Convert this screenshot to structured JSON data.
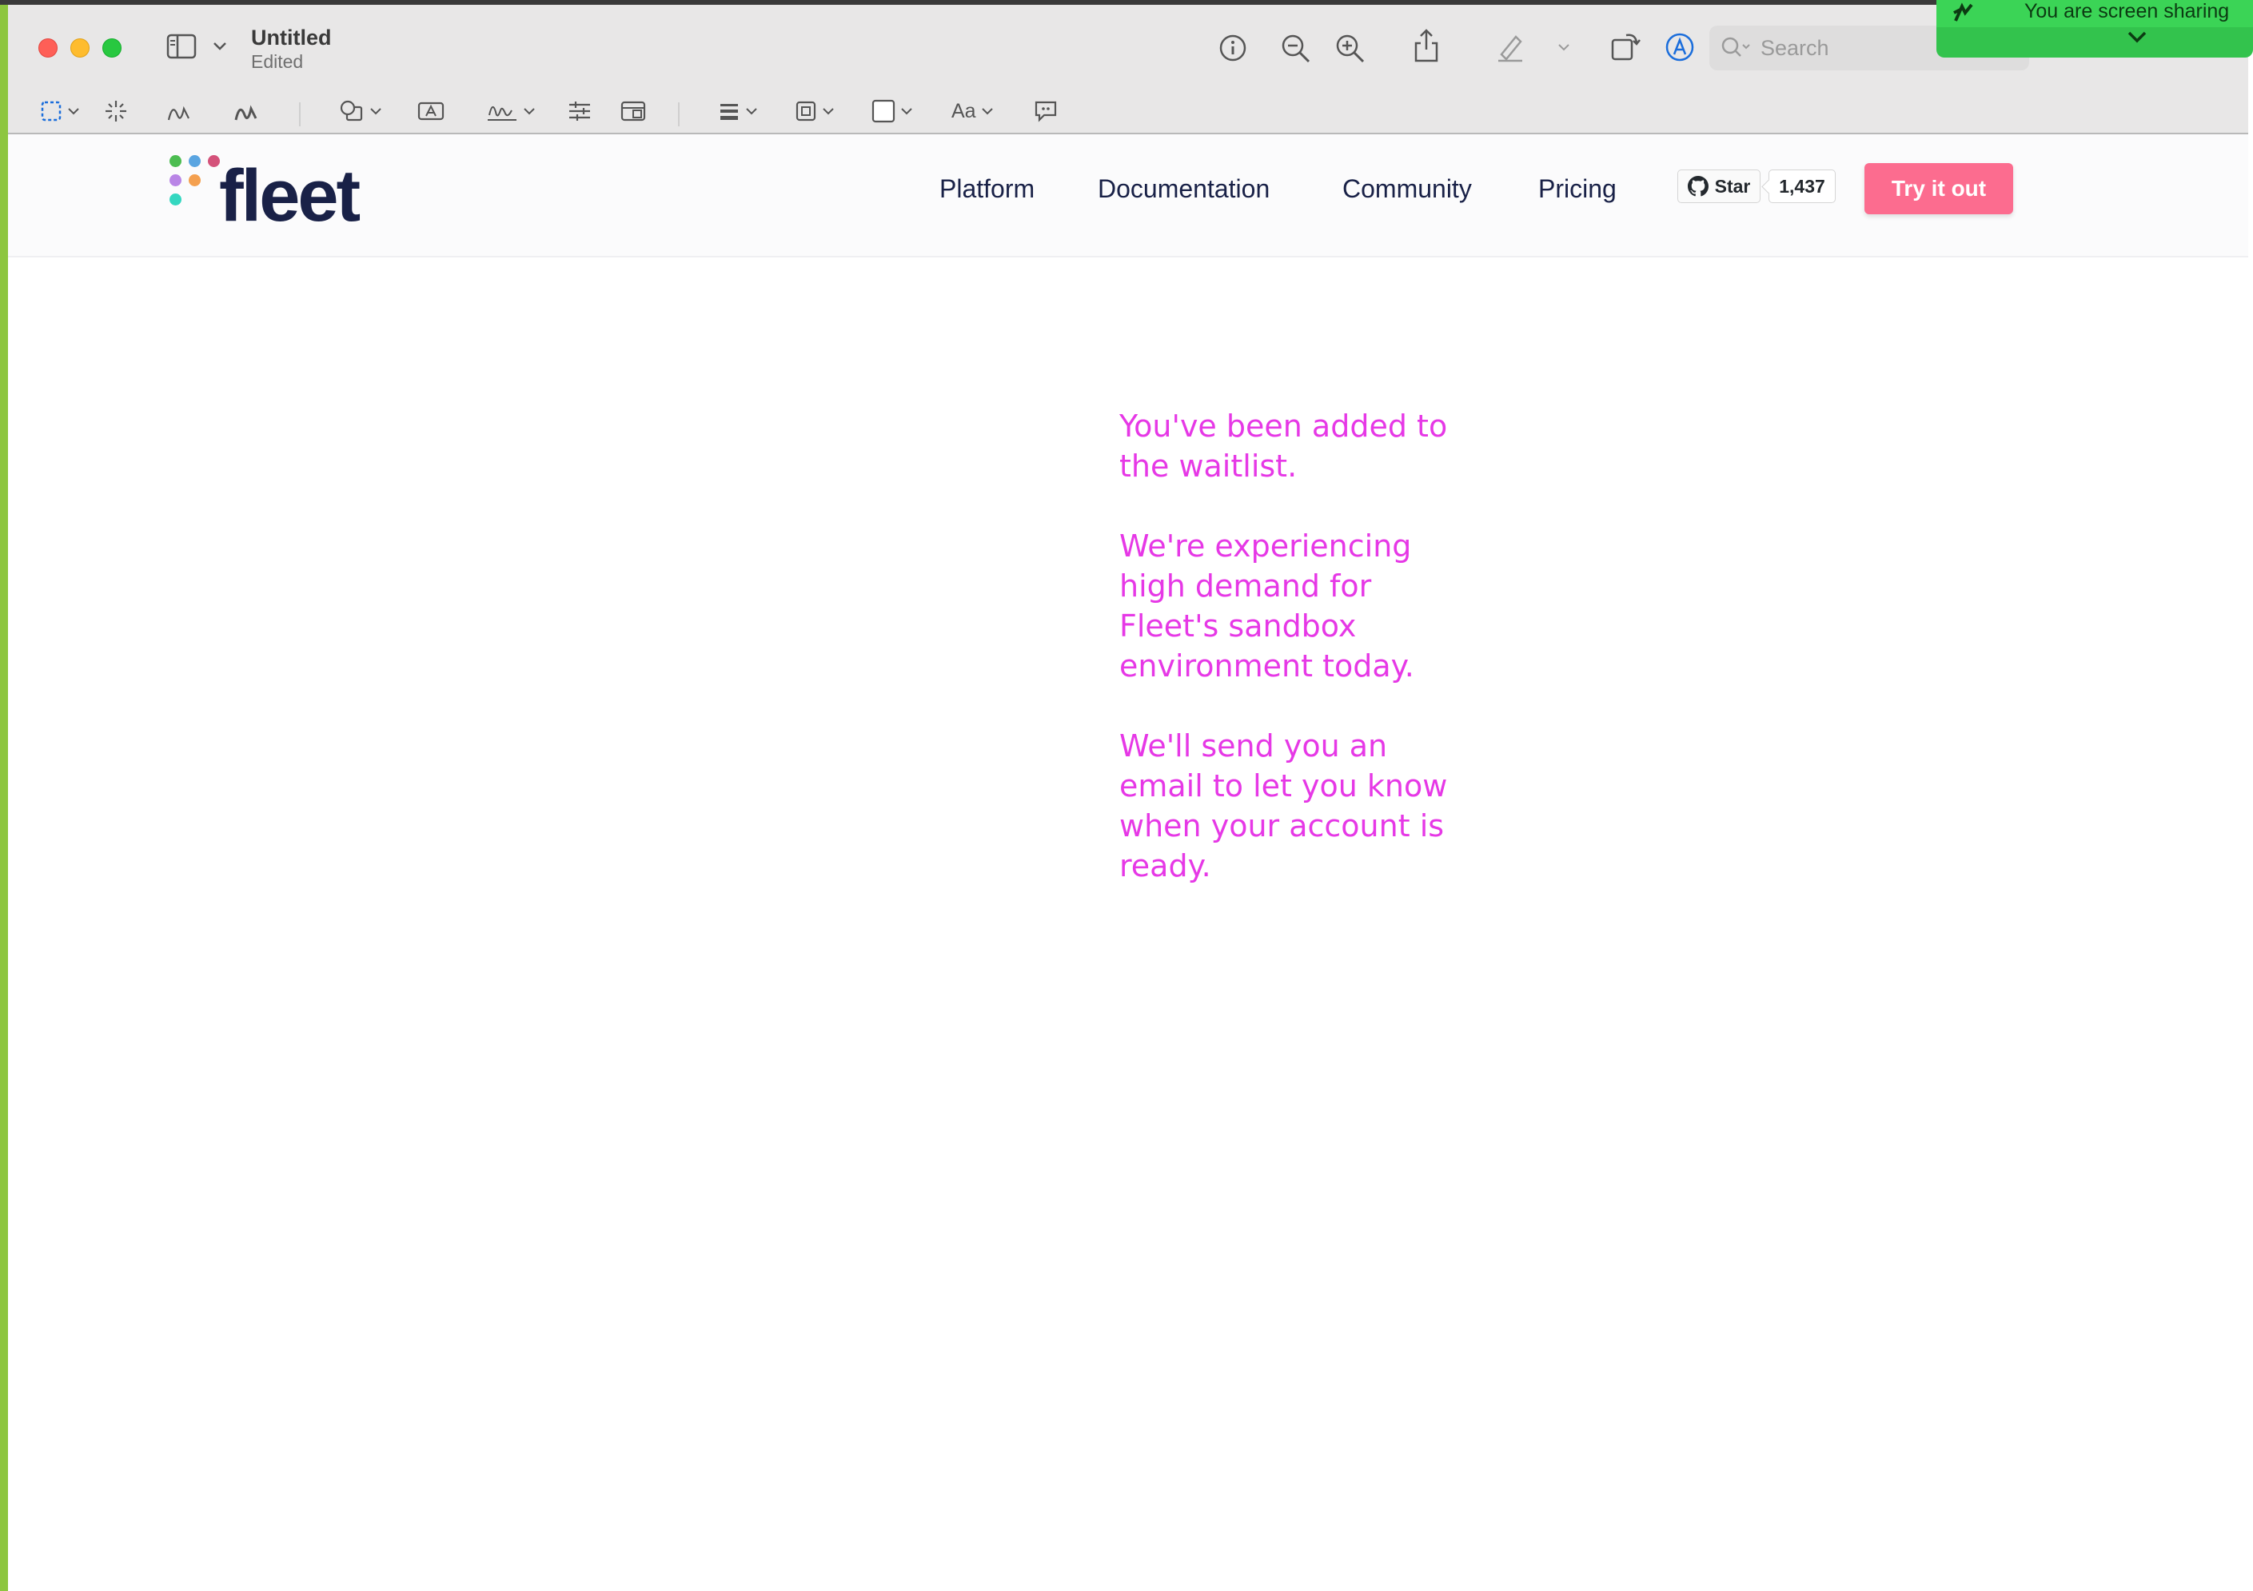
{
  "window": {
    "doc_title": "Untitled",
    "doc_subtitle": "Edited"
  },
  "toolbar": {
    "search_placeholder": "Search",
    "font_button_label": "Aa"
  },
  "screen_share": {
    "text": "You are screen sharing",
    "color": "#33c34d"
  },
  "site": {
    "logo_text": "fleet",
    "logo_dots": [
      "#4cbd51",
      "#5aa5e1",
      "#d4527a",
      "#b985e6",
      "#f4a04f",
      "#34d7c0"
    ],
    "nav": [
      "Platform",
      "Documentation",
      "Community",
      "Pricing"
    ],
    "github": {
      "star_label": "Star",
      "count": "1,437"
    },
    "cta_label": "Try it out",
    "cta_color": "#fc6c8f"
  },
  "message": {
    "p1": "You've been added to the waitlist.",
    "p2": "We're experiencing high demand for Fleet's sandbox environment today.",
    "p3": "We'll send you an email to let you  know when your account is ready.",
    "color": "#e638e6"
  }
}
